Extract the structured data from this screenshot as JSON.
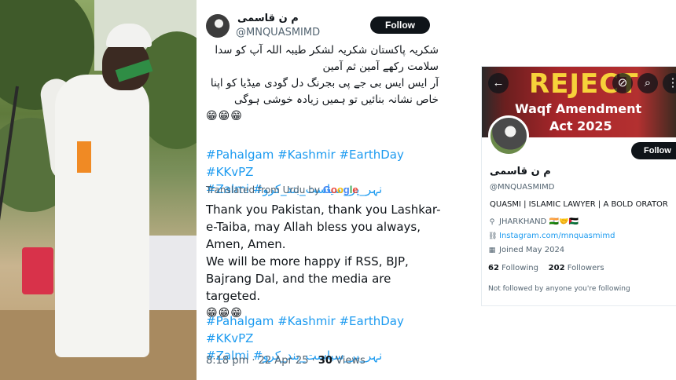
{
  "tweet": {
    "display_name": "م ن قاسمی",
    "handle": "@MNQUASMIMD",
    "follow_label": "Follow",
    "urdu_lines": [
      "شکریہ پاکستان شکریہ لشکر طیبہ اللہ آپ کو سدا",
      "سلامت رکھے آمین ثم آمین",
      "آر ایس ایس بی جے پی بجرنگ دل گودی میڈیا کو اپنا",
      "خاص نشانہ بنائیں تو ہمیں زیادہ خوشی ہوگی"
    ],
    "urdu_emojis": "😁😁😁",
    "hashtags_line1": "#Pahalgam #Kashmir #EarthDay #KKvPZ",
    "hashtags_line2": "#Zalmi #نہر_پر_سیاست_بند_کرو",
    "translated_prefix": "Translated from Urdu by",
    "translation_lines": [
      "Thank you Pakistan, thank you Lashkar-e-Taiba, may Allah bless you always, Amen, Amen.",
      "We will be more happy if RSS, BJP, Bajrang Dal, and the media are targeted."
    ],
    "translation_emojis": "😁😁😁",
    "hashtags2_line1": "#Pahalgam #Kashmir #EarthDay #KKvPZ",
    "hashtags2_line2": "#Zalmi #نہر_پر_سیاست_بند_کرو",
    "time": "8:18 pm · 22 Apr 25 · ",
    "views_count": "30",
    "views_label": " Views"
  },
  "profile": {
    "banner_line1": "REJECT",
    "banner_line2": "Waqf Amendment",
    "banner_line3": "Act 2025",
    "follow_label": "Follow",
    "name": "م ن قاسمی",
    "handle": "@MNQUASMIMD",
    "bio": "QUASMI | ISLAMIC LAWYER | A BOLD ORATOR",
    "location": "JHARKHAND 🇮🇳🤝🇵🇸",
    "link": "Instagram.com/mnquasmimd",
    "joined": "Joined May 2024",
    "following_count": "62",
    "following_label": " Following",
    "followers_count": "202",
    "followers_label": " Followers",
    "not_followed": "Not followed by anyone you're following"
  },
  "colors": {
    "link_blue": "#1d9bf0",
    "button_black": "#0f1419",
    "muted": "#536471",
    "banner_yellow": "#f7d23a",
    "banner_red": "#a8262a"
  },
  "icons": [
    "back-arrow-icon",
    "no-notifications-icon",
    "search-icon",
    "more-icon",
    "location-pin-icon",
    "link-icon",
    "calendar-icon"
  ]
}
